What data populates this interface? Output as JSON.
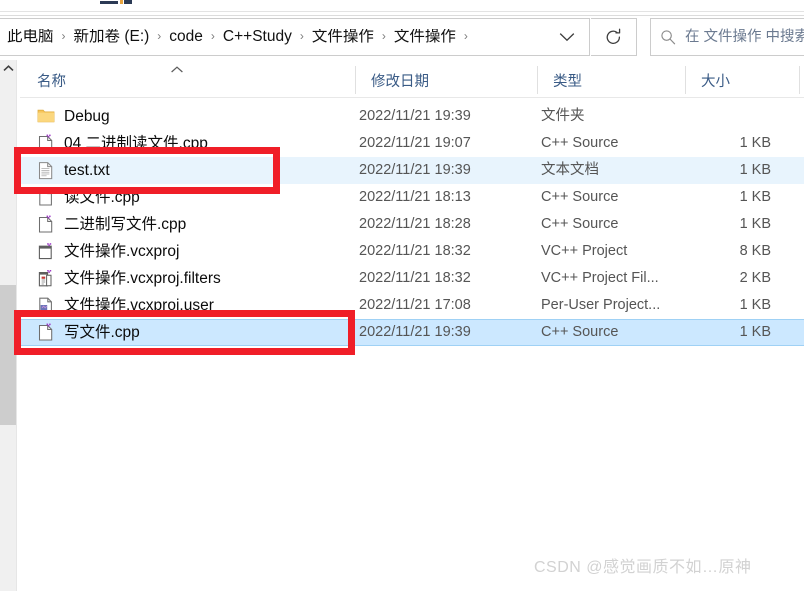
{
  "window": {
    "title_bar_visible": false
  },
  "address_bar": {
    "breadcrumbs": [
      "此电脑",
      "新加卷 (E:)",
      "code",
      "C++Study",
      "文件操作",
      "文件操作"
    ],
    "separator": "›",
    "dropdown_icon": "chevron-down-icon",
    "refresh_icon": "refresh-icon"
  },
  "search": {
    "icon": "search-icon",
    "placeholder": "在 文件操作 中搜索"
  },
  "columns": {
    "name": "名称",
    "date_modified": "修改日期",
    "type": "类型",
    "size": "大小",
    "sort_indicator": "sort-ascending-arrow-icon"
  },
  "files": [
    {
      "name": "Debug",
      "date": "2022/11/21 19:39",
      "type": "文件夹",
      "size": "",
      "icon": "folder-icon",
      "state": "normal"
    },
    {
      "name": "04 二进制读文件.cpp",
      "date": "2022/11/21 19:07",
      "type": "C++ Source",
      "size": "1 KB",
      "icon": "cpp-source-icon",
      "state": "normal"
    },
    {
      "name": "test.txt",
      "date": "2022/11/21 19:39",
      "type": "文本文档",
      "size": "1 KB",
      "icon": "text-document-icon",
      "state": "highlighted"
    },
    {
      "name": "读文件.cpp",
      "date": "2022/11/21 18:13",
      "type": "C++ Source",
      "size": "1 KB",
      "icon": "blank-file-icon",
      "state": "normal"
    },
    {
      "name": "二进制写文件.cpp",
      "date": "2022/11/21 18:28",
      "type": "C++ Source",
      "size": "1 KB",
      "icon": "cpp-source-icon",
      "state": "normal"
    },
    {
      "name": "文件操作.vcxproj",
      "date": "2022/11/21 18:32",
      "type": "VC++ Project",
      "size": "8 KB",
      "icon": "vcxproj-icon",
      "state": "normal"
    },
    {
      "name": "文件操作.vcxproj.filters",
      "date": "2022/11/21 18:32",
      "type": "VC++ Project Fil...",
      "size": "2 KB",
      "icon": "vcxproj-filters-icon",
      "state": "normal"
    },
    {
      "name": "文件操作.vcxproj.user",
      "date": "2022/11/21 17:08",
      "type": "Per-User Project...",
      "size": "1 KB",
      "icon": "vcxproj-user-icon",
      "state": "normal"
    },
    {
      "name": "写文件.cpp",
      "date": "2022/11/21 19:39",
      "type": "C++ Source",
      "size": "1 KB",
      "icon": "cpp-source-icon",
      "state": "selected"
    }
  ],
  "annotations": [
    {
      "id": "redbox-test",
      "target": "test.txt",
      "color": "#f01e28"
    },
    {
      "id": "redbox-write",
      "target": "写文件.cpp",
      "color": "#f01e28"
    }
  ],
  "watermark": {
    "text": "CSDN @感觉画质不如…原神"
  },
  "scrollbar": {
    "up_arrow_icon": "chevron-up-icon"
  },
  "colors": {
    "selection": "#cce8ff",
    "highlight": "#e8f4fd",
    "annotation": "#f01e28",
    "header_text": "#3a5b86"
  }
}
